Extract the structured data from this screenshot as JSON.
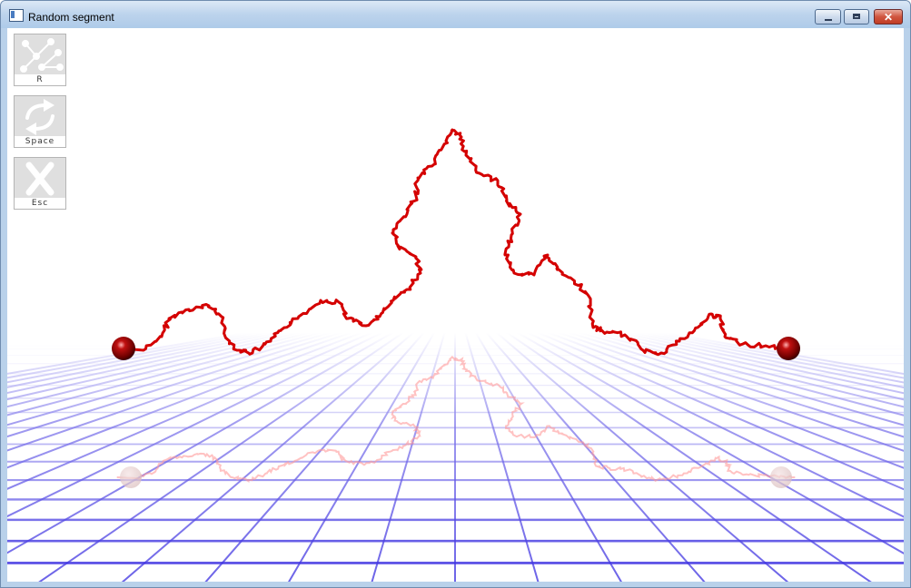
{
  "window": {
    "title": "Random segment"
  },
  "toolbar": {
    "items": [
      {
        "key": "R",
        "icon": "random-points-icon"
      },
      {
        "key": "Space",
        "icon": "swap-arrows-icon"
      },
      {
        "key": "Esc",
        "icon": "close-x-icon"
      }
    ]
  },
  "scene": {
    "curve_color": "#d40000",
    "grid_color": "#3b2fe0",
    "sphere_color": "#8b0000"
  }
}
